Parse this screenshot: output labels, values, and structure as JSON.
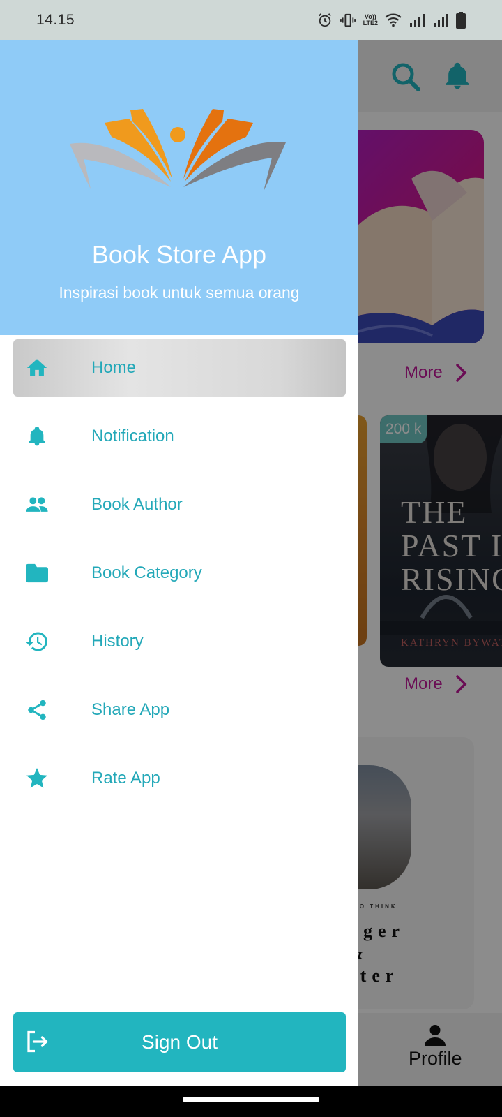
{
  "status_bar": {
    "time": "14.15",
    "icons": [
      "alarm-icon",
      "vibrate-icon",
      "volte-icon",
      "wifi-icon",
      "signal-icon",
      "signal-icon",
      "battery-icon"
    ],
    "volte_label_top": "Vo))",
    "volte_label_bottom": "LTE2"
  },
  "background": {
    "header_icons": [
      "search-icon",
      "bell-icon"
    ],
    "more_label_1": "More",
    "more_label_2": "More",
    "book_badge": "200 k",
    "book_title": "THE\nPAST IS\nRISING",
    "book_author": "KATHRYN BYWATERS",
    "book3_small": "TO THINK",
    "book3_big": "gger\n&\ntter",
    "bottom_tab_label": "Profile"
  },
  "drawer": {
    "title": "Book Store App",
    "tagline": "Inspirasi book untuk semua orang",
    "items": [
      {
        "label": "Home",
        "icon": "home-icon",
        "active": true
      },
      {
        "label": "Notification",
        "icon": "bell-icon"
      },
      {
        "label": "Book Author",
        "icon": "people-icon"
      },
      {
        "label": "Book Category",
        "icon": "folder-icon"
      },
      {
        "label": "History",
        "icon": "history-icon"
      },
      {
        "label": "Share App",
        "icon": "share-icon"
      },
      {
        "label": "Rate App",
        "icon": "star-icon"
      }
    ],
    "sign_out_label": "Sign Out"
  },
  "colors": {
    "accent": "#22b5bf",
    "header_bg": "#8fcbf7",
    "menu_text": "#23a8b8",
    "more_text": "#c2179a"
  }
}
